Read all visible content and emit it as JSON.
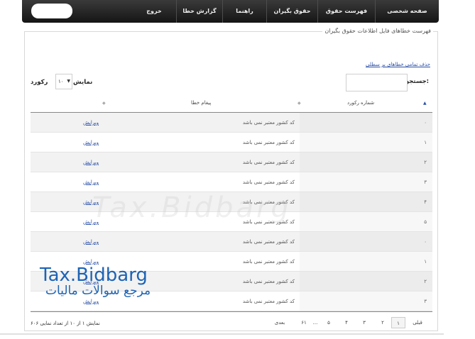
{
  "nav": {
    "items": [
      {
        "label": "صفحه شخصی"
      },
      {
        "label": "فهرست حقوق"
      },
      {
        "label": "حقوق بگیران"
      },
      {
        "label": "راهنما"
      },
      {
        "label": "گزارش خطا"
      },
      {
        "label": "خروج"
      }
    ]
  },
  "panel": {
    "title": "فهرست خطاهای فایل اطلاعات حقوق بگیران",
    "delete_all": "حذف تمامی خطاهای بر سطلی"
  },
  "controls": {
    "search_label": "جستجو:",
    "search_value": "",
    "show_label": "نمایش",
    "page_length": "۱۰",
    "records_label": "رکورد"
  },
  "table": {
    "headers": {
      "record_no": "شماره رکورد",
      "error_message": "پیغام خطا",
      "actions": ""
    },
    "rows": [
      {
        "id": "۰",
        "message": "کد کشور معتبر نمی باشد",
        "action": "ویرایش"
      },
      {
        "id": "۱",
        "message": "کد کشور معتبر نمی باشد",
        "action": "ویرایش"
      },
      {
        "id": "۲",
        "message": "کد کشور معتبر نمی باشد",
        "action": "ویرایش"
      },
      {
        "id": "۳",
        "message": "کد کشور معتبر نمی باشد",
        "action": "ویرایش"
      },
      {
        "id": "۴",
        "message": "کد کشور معتبر نمی باشد",
        "action": "ویرایش"
      },
      {
        "id": "۵",
        "message": "کد کشور معتبر نمی باشد",
        "action": "ویرایش"
      },
      {
        "id": "۰",
        "message": "کد کشور معتبر نمی باشد",
        "action": "ویرایش"
      },
      {
        "id": "۱",
        "message": "کد کشور معتبر نمی باشد",
        "action": "ویرایش"
      },
      {
        "id": "۲",
        "message": "کد کشور معتبر نمی باشد",
        "action": "ویرایش"
      },
      {
        "id": "۳",
        "message": "کد کشور معتبر نمی باشد",
        "action": "ویرایش"
      }
    ]
  },
  "footer": {
    "info": "نمایش ۱ از ۱۰ از تعداد نمایی ۶۰۶",
    "pagination": {
      "prev": "قبلی",
      "pages": [
        "۱",
        "۲",
        "۳",
        "۴",
        "۵"
      ],
      "ellipsis": "...",
      "last": "۶۱",
      "next": "بعدی",
      "current": "۱"
    }
  },
  "watermark": {
    "brand": "Tax.Bidbarg",
    "tagline": "مرجع سوالات مالیات",
    "faint": "Tax.Bidbarg"
  },
  "colors": {
    "nav_bg": "#1f1f1f",
    "link": "#2a4fa8",
    "brand": "#1d63b5"
  }
}
